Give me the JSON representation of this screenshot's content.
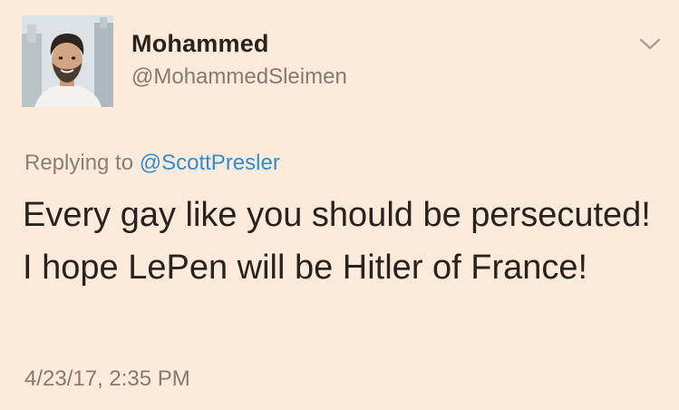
{
  "user": {
    "display_name": "Mohammed",
    "handle": "@MohammedSleimen",
    "avatar_icon": "profile-photo"
  },
  "menu": {
    "icon": "chevron-down-icon"
  },
  "reply": {
    "prefix": "Replying to",
    "mention": "@ScottPresler"
  },
  "tweet": {
    "text": "Every gay like you should be persecuted! I hope LePen will be Hitler of France!",
    "timestamp": "4/23/17, 2:35 PM"
  },
  "colors": {
    "background": "#FCEADA",
    "link": "#2E8ECF",
    "muted": "#857A70",
    "text": "#2A221D"
  }
}
